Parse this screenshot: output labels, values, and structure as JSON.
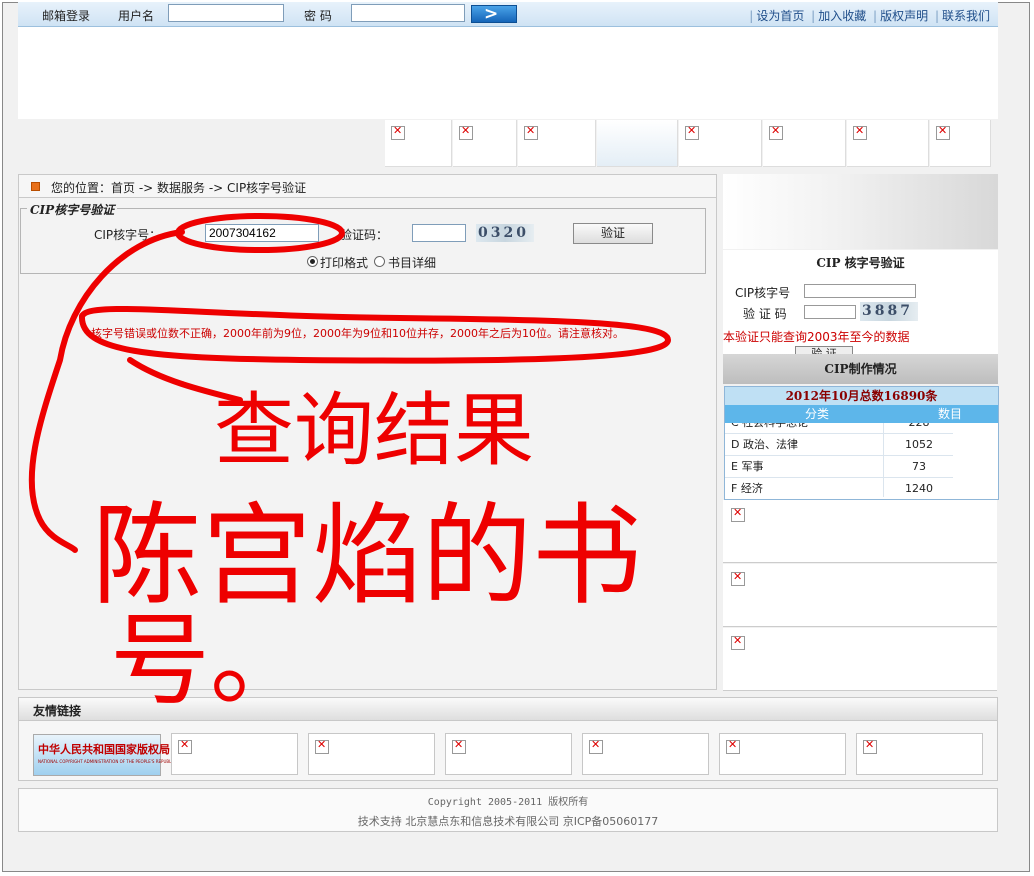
{
  "topbar": {
    "email_login": "邮箱登录",
    "username_label": "用户名",
    "password_label": "密 码",
    "links": [
      "设为首页",
      "加入收藏",
      "版权声明",
      "联系我们"
    ]
  },
  "breadcrumb": "您的位置：首页 -> 数据服务 -> CIP核字号验证",
  "form": {
    "legend": "CIP核字号验证",
    "cip_label": "CIP核字号：",
    "cip_value": "2007304162",
    "code_label": "验证码：",
    "code_value": "",
    "captcha": "0320",
    "verify_button": "验证",
    "radio_print": "打印格式",
    "radio_detail": "书目详细"
  },
  "result_message": "核字号错误或位数不正确，2000年前为9位，2000年为9位和10位并存，2000年之后为10位。请注意核对。",
  "handwriting": [
    "查询结果",
    "陈宫焰的书",
    "号。"
  ],
  "sidebar": {
    "cip_title": "CIP 核字号验证",
    "cip_label": "CIP核字号",
    "code_label": "验 证 码",
    "captcha": "3887",
    "note": "本验证只能查询2003年至今的数据",
    "button": "验 证",
    "status_title": "CIP制作情况",
    "total": "2012年10月总数16890条",
    "col_category": "分类",
    "col_count": "数目",
    "rows": [
      {
        "category": "C 社会科学总论",
        "count": "228"
      },
      {
        "category": "D 政治、法律",
        "count": "1052"
      },
      {
        "category": "E 军事",
        "count": "73"
      },
      {
        "category": "F 经济",
        "count": "1240"
      }
    ]
  },
  "friend_links": {
    "title": "友情链接",
    "logo_text": "中华人民共和国国家版权局",
    "logo_subtext": "NATIONAL COPYRIGHT ADMINISTRATION OF THE PEOPLE'S REPUBLIC OF CHINA"
  },
  "footer": {
    "copyright": "Copyright 2005-2011 版权所有",
    "support": "技术支持 北京慧点东和信息技术有限公司 京ICP备05060177"
  }
}
